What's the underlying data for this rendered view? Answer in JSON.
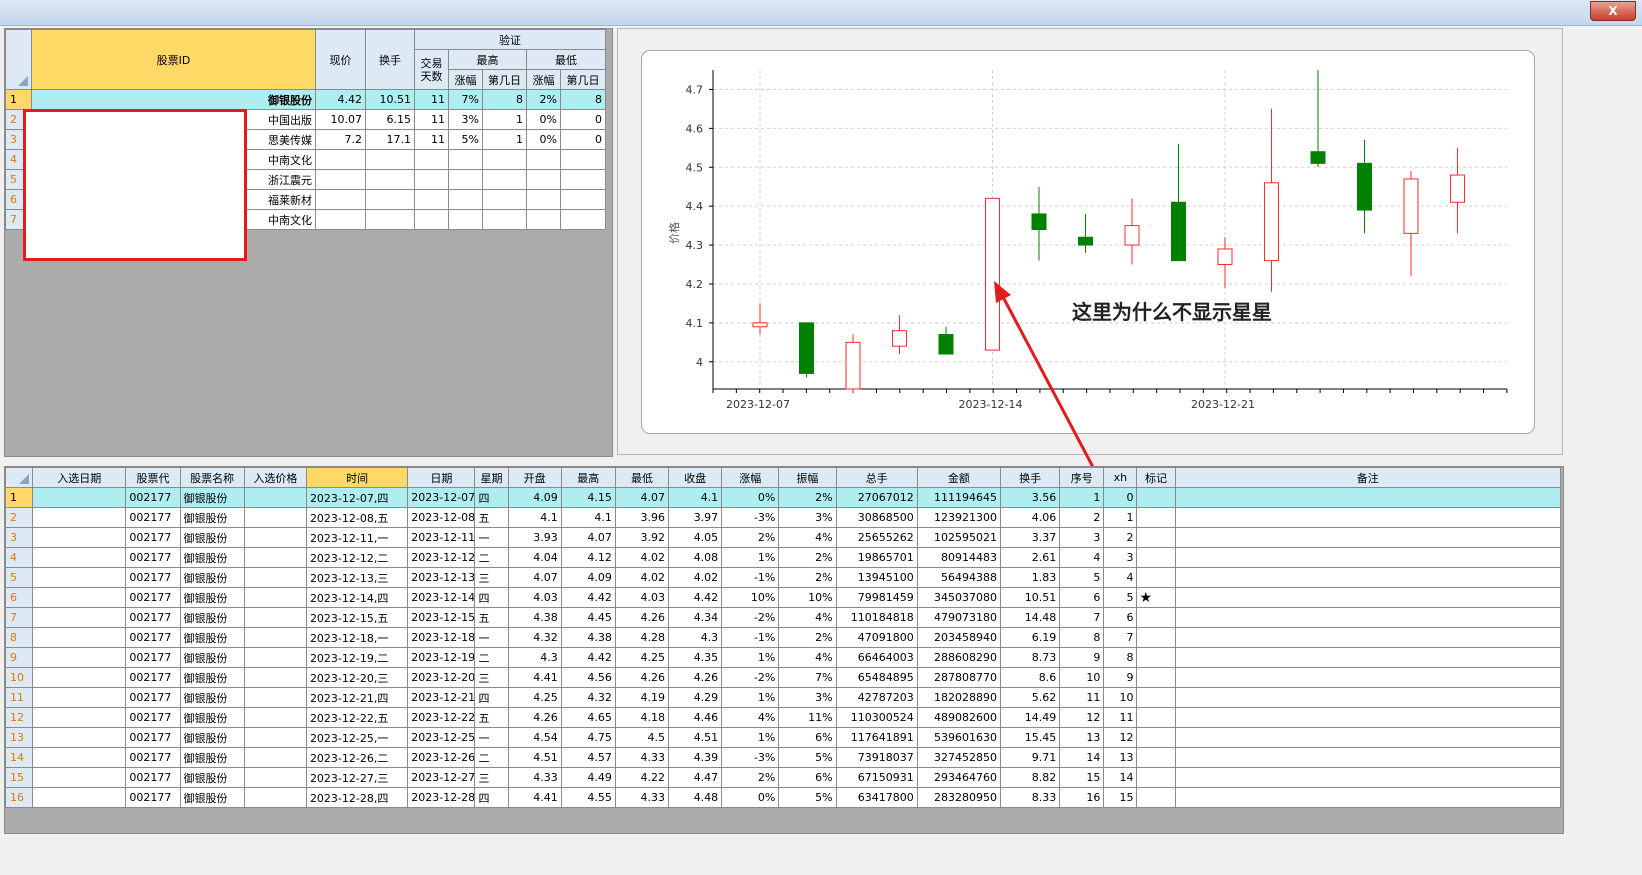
{
  "window": {
    "close_label": "X"
  },
  "top_table": {
    "headers": {
      "stock_id": "股票ID",
      "price": "现价",
      "turnover": "换手",
      "verify": "验证",
      "trade_days": "交易\n天数",
      "highest": "最高",
      "lowest": "最低",
      "change": "涨幅",
      "day_n": "第几日"
    },
    "rows": [
      {
        "no": "1",
        "name": "御银股份",
        "price": "4.42",
        "turnover": "10.51",
        "days": "11",
        "hi_chg": "7%",
        "hi_day": "8",
        "lo_chg": "2%",
        "lo_day": "8"
      },
      {
        "no": "2",
        "name": "中国出版",
        "price": "10.07",
        "turnover": "6.15",
        "days": "11",
        "hi_chg": "3%",
        "hi_day": "1",
        "lo_chg": "0%",
        "lo_day": "0"
      },
      {
        "no": "3",
        "name": "思美传媒",
        "price": "7.2",
        "turnover": "17.1",
        "days": "11",
        "hi_chg": "5%",
        "hi_day": "1",
        "lo_chg": "0%",
        "lo_day": "0"
      },
      {
        "no": "4",
        "name": "中南文化",
        "price": "",
        "turnover": "",
        "days": "",
        "hi_chg": "",
        "hi_day": "",
        "lo_chg": "",
        "lo_day": ""
      },
      {
        "no": "5",
        "name": "浙江震元",
        "price": "",
        "turnover": "",
        "days": "",
        "hi_chg": "",
        "hi_day": "",
        "lo_chg": "",
        "lo_day": ""
      },
      {
        "no": "6",
        "name": "福莱新材",
        "price": "",
        "turnover": "",
        "days": "",
        "hi_chg": "",
        "hi_day": "",
        "lo_chg": "",
        "lo_day": ""
      },
      {
        "no": "7",
        "name": "中南文化",
        "price": "",
        "turnover": "",
        "days": "",
        "hi_chg": "",
        "hi_day": "",
        "lo_chg": "",
        "lo_day": ""
      }
    ]
  },
  "chart_data": {
    "type": "candlestick",
    "ylabel": "价格",
    "ylim": [
      3.93,
      4.75
    ],
    "yticks": [
      "4",
      "4.1",
      "4.2",
      "4.3",
      "4.4",
      "4.5",
      "4.6",
      "4.7"
    ],
    "xticks": [
      "2023-12-07",
      "2023-12-14",
      "2023-12-21"
    ],
    "candles": [
      {
        "date": "2023-12-07",
        "open": 4.09,
        "high": 4.15,
        "low": 4.07,
        "close": 4.1
      },
      {
        "date": "2023-12-08",
        "open": 4.1,
        "high": 4.1,
        "low": 3.96,
        "close": 3.97
      },
      {
        "date": "2023-12-11",
        "open": 3.93,
        "high": 4.07,
        "low": 3.92,
        "close": 4.05
      },
      {
        "date": "2023-12-12",
        "open": 4.04,
        "high": 4.12,
        "low": 4.02,
        "close": 4.08
      },
      {
        "date": "2023-12-13",
        "open": 4.07,
        "high": 4.09,
        "low": 4.02,
        "close": 4.02
      },
      {
        "date": "2023-12-14",
        "open": 4.03,
        "high": 4.42,
        "low": 4.03,
        "close": 4.42
      },
      {
        "date": "2023-12-15",
        "open": 4.38,
        "high": 4.45,
        "low": 4.26,
        "close": 4.34
      },
      {
        "date": "2023-12-18",
        "open": 4.32,
        "high": 4.38,
        "low": 4.28,
        "close": 4.3
      },
      {
        "date": "2023-12-19",
        "open": 4.3,
        "high": 4.42,
        "low": 4.25,
        "close": 4.35
      },
      {
        "date": "2023-12-20",
        "open": 4.41,
        "high": 4.56,
        "low": 4.26,
        "close": 4.26
      },
      {
        "date": "2023-12-21",
        "open": 4.25,
        "high": 4.32,
        "low": 4.19,
        "close": 4.29
      },
      {
        "date": "2023-12-22",
        "open": 4.26,
        "high": 4.65,
        "low": 4.18,
        "close": 4.46
      },
      {
        "date": "2023-12-25",
        "open": 4.54,
        "high": 4.75,
        "low": 4.5,
        "close": 4.51
      },
      {
        "date": "2023-12-26",
        "open": 4.51,
        "high": 4.57,
        "low": 4.33,
        "close": 4.39
      },
      {
        "date": "2023-12-27",
        "open": 4.33,
        "high": 4.49,
        "low": 4.22,
        "close": 4.47
      },
      {
        "date": "2023-12-28",
        "open": 4.41,
        "high": 4.55,
        "low": 4.33,
        "close": 4.48
      }
    ],
    "up_color": "#ff2a2a",
    "down_color": "#008000"
  },
  "annotation": {
    "text": "这里为什么不显示星星",
    "color": "#e31b1b"
  },
  "bottom_table": {
    "headers": [
      "入选日期",
      "股票代",
      "股票名称",
      "入选价格",
      "时间",
      "日期",
      "星期",
      "开盘",
      "最高",
      "最低",
      "收盘",
      "涨幅",
      "振幅",
      "总手",
      "金额",
      "换手",
      "序号",
      "xh",
      "标记",
      "备注"
    ],
    "rows": [
      [
        "",
        "002177",
        "御银股份",
        "",
        "2023-12-07,四",
        "2023-12-07",
        "四",
        "4.09",
        "4.15",
        "4.07",
        "4.1",
        "0%",
        "2%",
        "27067012",
        "111194645",
        "3.56",
        "1",
        "0",
        "",
        ""
      ],
      [
        "",
        "002177",
        "御银股份",
        "",
        "2023-12-08,五",
        "2023-12-08",
        "五",
        "4.1",
        "4.1",
        "3.96",
        "3.97",
        "-3%",
        "3%",
        "30868500",
        "123921300",
        "4.06",
        "2",
        "1",
        "",
        ""
      ],
      [
        "",
        "002177",
        "御银股份",
        "",
        "2023-12-11,一",
        "2023-12-11",
        "一",
        "3.93",
        "4.07",
        "3.92",
        "4.05",
        "2%",
        "4%",
        "25655262",
        "102595021",
        "3.37",
        "3",
        "2",
        "",
        ""
      ],
      [
        "",
        "002177",
        "御银股份",
        "",
        "2023-12-12,二",
        "2023-12-12",
        "二",
        "4.04",
        "4.12",
        "4.02",
        "4.08",
        "1%",
        "2%",
        "19865701",
        "80914483",
        "2.61",
        "4",
        "3",
        "",
        ""
      ],
      [
        "",
        "002177",
        "御银股份",
        "",
        "2023-12-13,三",
        "2023-12-13",
        "三",
        "4.07",
        "4.09",
        "4.02",
        "4.02",
        "-1%",
        "2%",
        "13945100",
        "56494388",
        "1.83",
        "5",
        "4",
        "",
        ""
      ],
      [
        "",
        "002177",
        "御银股份",
        "",
        "2023-12-14,四",
        "2023-12-14",
        "四",
        "4.03",
        "4.42",
        "4.03",
        "4.42",
        "10%",
        "10%",
        "79981459",
        "345037080",
        "10.51",
        "6",
        "5",
        "★",
        ""
      ],
      [
        "",
        "002177",
        "御银股份",
        "",
        "2023-12-15,五",
        "2023-12-15",
        "五",
        "4.38",
        "4.45",
        "4.26",
        "4.34",
        "-2%",
        "4%",
        "110184818",
        "479073180",
        "14.48",
        "7",
        "6",
        "",
        ""
      ],
      [
        "",
        "002177",
        "御银股份",
        "",
        "2023-12-18,一",
        "2023-12-18",
        "一",
        "4.32",
        "4.38",
        "4.28",
        "4.3",
        "-1%",
        "2%",
        "47091800",
        "203458940",
        "6.19",
        "8",
        "7",
        "",
        ""
      ],
      [
        "",
        "002177",
        "御银股份",
        "",
        "2023-12-19,二",
        "2023-12-19",
        "二",
        "4.3",
        "4.42",
        "4.25",
        "4.35",
        "1%",
        "4%",
        "66464003",
        "288608290",
        "8.73",
        "9",
        "8",
        "",
        ""
      ],
      [
        "",
        "002177",
        "御银股份",
        "",
        "2023-12-20,三",
        "2023-12-20",
        "三",
        "4.41",
        "4.56",
        "4.26",
        "4.26",
        "-2%",
        "7%",
        "65484895",
        "287808770",
        "8.6",
        "10",
        "9",
        "",
        ""
      ],
      [
        "",
        "002177",
        "御银股份",
        "",
        "2023-12-21,四",
        "2023-12-21",
        "四",
        "4.25",
        "4.32",
        "4.19",
        "4.29",
        "1%",
        "3%",
        "42787203",
        "182028890",
        "5.62",
        "11",
        "10",
        "",
        ""
      ],
      [
        "",
        "002177",
        "御银股份",
        "",
        "2023-12-22,五",
        "2023-12-22",
        "五",
        "4.26",
        "4.65",
        "4.18",
        "4.46",
        "4%",
        "11%",
        "110300524",
        "489082600",
        "14.49",
        "12",
        "11",
        "",
        ""
      ],
      [
        "",
        "002177",
        "御银股份",
        "",
        "2023-12-25,一",
        "2023-12-25",
        "一",
        "4.54",
        "4.75",
        "4.5",
        "4.51",
        "1%",
        "6%",
        "117641891",
        "539601630",
        "15.45",
        "13",
        "12",
        "",
        ""
      ],
      [
        "",
        "002177",
        "御银股份",
        "",
        "2023-12-26,二",
        "2023-12-26",
        "二",
        "4.51",
        "4.57",
        "4.33",
        "4.39",
        "-3%",
        "5%",
        "73918037",
        "327452850",
        "9.71",
        "14",
        "13",
        "",
        ""
      ],
      [
        "",
        "002177",
        "御银股份",
        "",
        "2023-12-27,三",
        "2023-12-27",
        "三",
        "4.33",
        "4.49",
        "4.22",
        "4.47",
        "2%",
        "6%",
        "67150931",
        "293464760",
        "8.82",
        "15",
        "14",
        "",
        ""
      ],
      [
        "",
        "002177",
        "御银股份",
        "",
        "2023-12-28,四",
        "2023-12-28",
        "四",
        "4.41",
        "4.55",
        "4.33",
        "4.48",
        "0%",
        "5%",
        "63417800",
        "283280950",
        "8.33",
        "16",
        "15",
        "",
        ""
      ]
    ]
  }
}
